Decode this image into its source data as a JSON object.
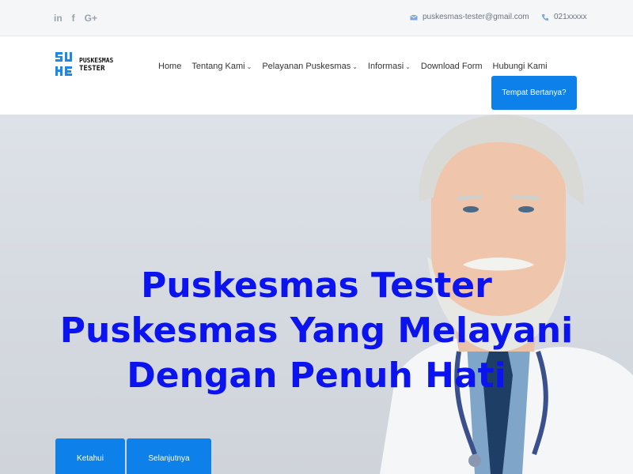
{
  "topbar": {
    "social": [
      {
        "icon": "linkedin-icon",
        "glyph": "in"
      },
      {
        "icon": "facebook-icon",
        "glyph": "f"
      },
      {
        "icon": "google-plus-icon",
        "glyph": "G+"
      }
    ],
    "email": "puskesmas-tester@gmail.com",
    "phone": "021xxxxx"
  },
  "header": {
    "logo_line1": "PUSKESMAS",
    "logo_line2": "TESTER",
    "nav": [
      {
        "label": "Home",
        "dropdown": false
      },
      {
        "label": "Tentang Kami",
        "dropdown": true
      },
      {
        "label": "Pelayanan Puskesmas",
        "dropdown": true
      },
      {
        "label": "Informasi",
        "dropdown": true
      },
      {
        "label": "Download Form",
        "dropdown": false
      },
      {
        "label": "Hubungi Kami",
        "dropdown": false
      }
    ],
    "cta_label": "Tempat Bertanya?"
  },
  "hero": {
    "title_lines": [
      "Puskesmas Tester",
      "Puskesmas Yang Melayani",
      "Dengan Penuh Hati"
    ],
    "button1": "Ketahui",
    "button2": "Selanjutnya"
  },
  "colors": {
    "accent": "#0d80ea",
    "hero_text": "#0b13ee",
    "topbar_bg": "#f5f6f8"
  }
}
